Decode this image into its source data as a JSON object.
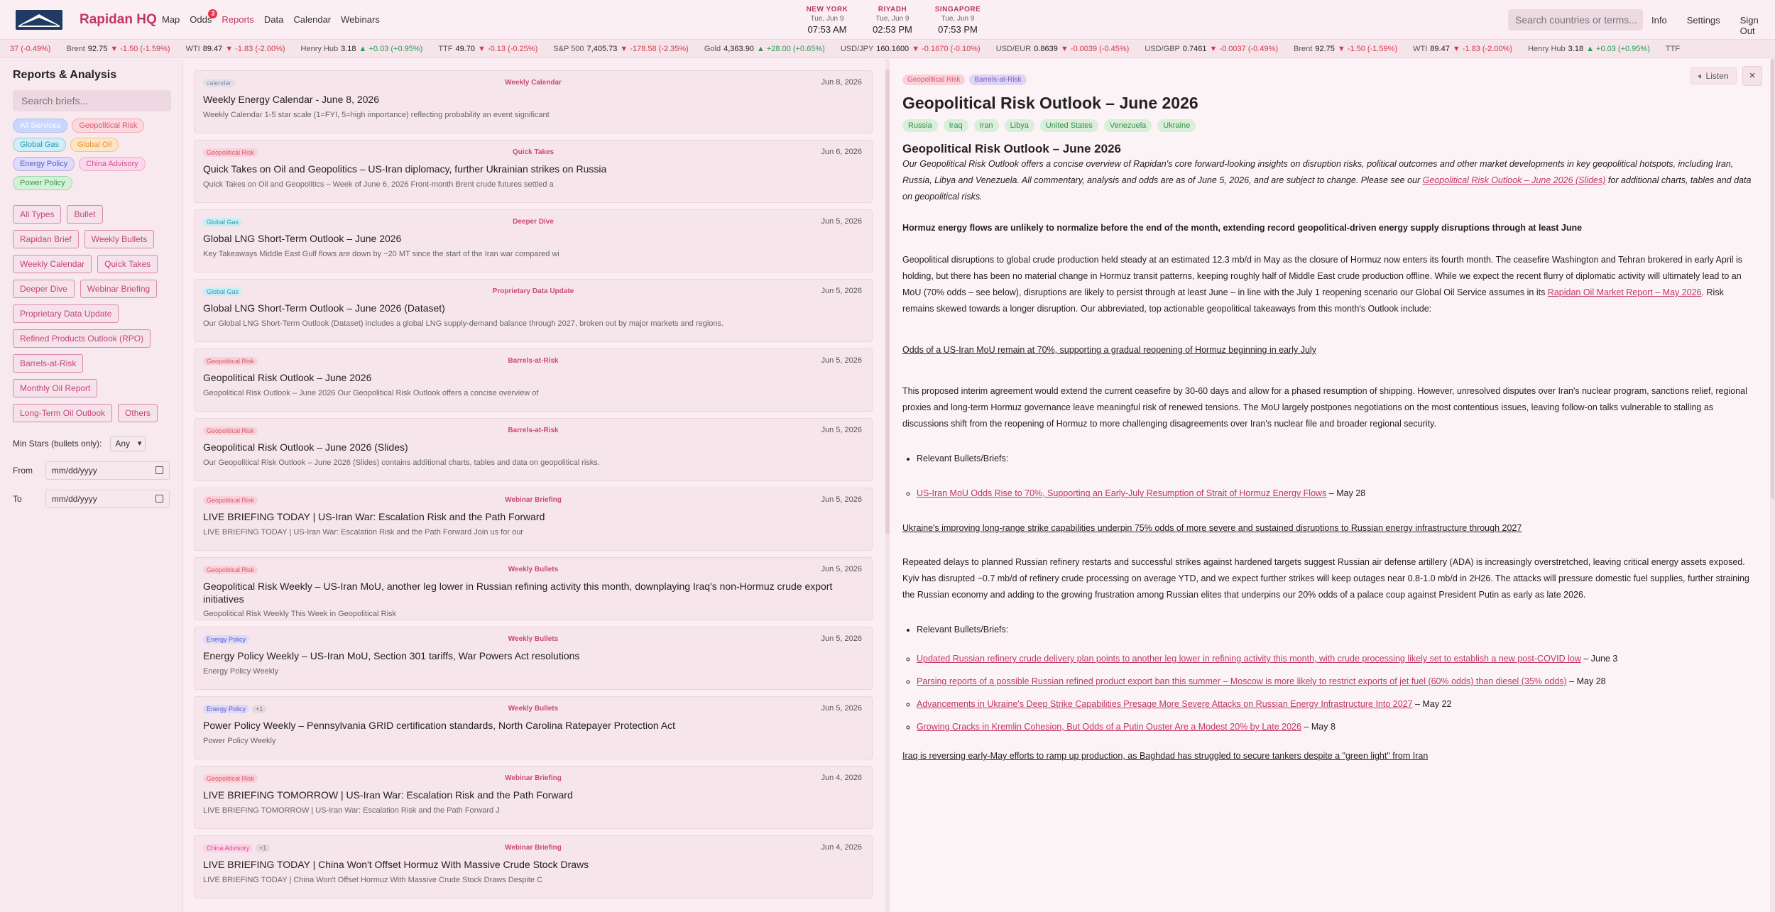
{
  "header": {
    "brand": "Rapidan HQ",
    "nav": [
      {
        "label": "Map",
        "active": false,
        "badge": ""
      },
      {
        "label": "Odds",
        "active": false,
        "badge": "3"
      },
      {
        "label": "Reports",
        "active": true,
        "badge": ""
      },
      {
        "label": "Data",
        "active": false,
        "badge": ""
      },
      {
        "label": "Calendar",
        "active": false,
        "badge": ""
      },
      {
        "label": "Webinars",
        "active": false,
        "badge": ""
      }
    ],
    "clocks": [
      {
        "city": "NEW YORK",
        "date": "Tue, Jun 9",
        "time": "07:53 AM"
      },
      {
        "city": "RIYADH",
        "date": "Tue, Jun 9",
        "time": "02:53 PM"
      },
      {
        "city": "SINGAPORE",
        "date": "Tue, Jun 9",
        "time": "07:53 PM"
      }
    ],
    "search_placeholder": "Search countries or terms...",
    "links": [
      "Info",
      "Settings",
      "Sign Out"
    ]
  },
  "ticker": [
    {
      "name": "",
      "value": "",
      "change": "37 (-0.49%)",
      "dir": "down"
    },
    {
      "name": "Brent",
      "value": "92.75",
      "change": "▼ -1.50 (-1.59%)",
      "dir": "down"
    },
    {
      "name": "WTI",
      "value": "89.47",
      "change": "▼ -1.83 (-2.00%)",
      "dir": "down"
    },
    {
      "name": "Henry Hub",
      "value": "3.18",
      "change": "▲ +0.03 (+0.95%)",
      "dir": "up"
    },
    {
      "name": "TTF",
      "value": "49.70",
      "change": "▼ -0.13 (-0.25%)",
      "dir": "down"
    },
    {
      "name": "S&P 500",
      "value": "7,405.73",
      "change": "▼ -178.58 (-2.35%)",
      "dir": "down"
    },
    {
      "name": "Gold",
      "value": "4,363.90",
      "change": "▲ +28.00 (+0.65%)",
      "dir": "up"
    },
    {
      "name": "USD/JPY",
      "value": "160.1600",
      "change": "▼ -0.1670 (-0.10%)",
      "dir": "down"
    },
    {
      "name": "USD/EUR",
      "value": "0.8639",
      "change": "▼ -0.0039 (-0.45%)",
      "dir": "down"
    },
    {
      "name": "USD/GBP",
      "value": "0.7461",
      "change": "▼ -0.0037 (-0.49%)",
      "dir": "down"
    },
    {
      "name": "Brent",
      "value": "92.75",
      "change": "▼ -1.50 (-1.59%)",
      "dir": "down"
    },
    {
      "name": "WTI",
      "value": "89.47",
      "change": "▼ -1.83 (-2.00%)",
      "dir": "down"
    },
    {
      "name": "Henry Hub",
      "value": "3.18",
      "change": "▲ +0.03 (+0.95%)",
      "dir": "up"
    },
    {
      "name": "TTF",
      "value": "",
      "change": "",
      "dir": "down"
    }
  ],
  "sidebar": {
    "title": "Reports & Analysis",
    "search_placeholder": "Search briefs...",
    "topic_chips": [
      {
        "label": "All Services",
        "cls": "all"
      },
      {
        "label": "Geopolitical Risk",
        "cls": "geo"
      },
      {
        "label": "Global Gas",
        "cls": "gas"
      },
      {
        "label": "Global Oil",
        "cls": "oil"
      },
      {
        "label": "Energy Policy",
        "cls": "energy"
      },
      {
        "label": "China Advisory",
        "cls": "china"
      },
      {
        "label": "Power Policy",
        "cls": "power"
      }
    ],
    "types": [
      "All Types",
      "Bullet",
      "Rapidan Brief",
      "Weekly Bullets",
      "Weekly Calendar",
      "Quick Takes",
      "Deeper Dive",
      "Webinar Briefing",
      "Proprietary Data Update",
      "Refined Products Outlook (RPO)",
      "Barrels-at-Risk",
      "Monthly Oil Report",
      "Long-Term Oil Outlook",
      "Others"
    ],
    "min_stars_label": "Min Stars (bullets only):",
    "min_stars_value": "Any",
    "from_label": "From",
    "to_label": "To",
    "date_placeholder": "mm/dd/yyyy"
  },
  "list": [
    {
      "tag": "calendar",
      "tag_cls": "calendar",
      "extra": "",
      "type": "Weekly Calendar",
      "date": "Jun 8, 2026",
      "title": "Weekly Energy Calendar - June 8, 2026",
      "excerpt": "Weekly Calendar 1-5 star scale (1=FYI, 5=high importance) reflecting probability an event significant"
    },
    {
      "tag": "Geopolitical Risk",
      "tag_cls": "geo",
      "extra": "",
      "type": "Quick Takes",
      "date": "Jun 6, 2026",
      "title": "Quick Takes on Oil and Geopolitics – US-Iran diplomacy, further Ukrainian strikes on Russia",
      "excerpt": "Quick Takes on Oil and Geopolitics – Week of June 6, 2026 Front-month Brent crude futures settled a"
    },
    {
      "tag": "Global Gas",
      "tag_cls": "gas",
      "extra": "",
      "type": "Deeper Dive",
      "date": "Jun 5, 2026",
      "title": "Global LNG Short-Term Outlook – June 2026",
      "excerpt": "Key Takeaways Middle East Gulf flows are down by ~20 MT since the start of the Iran war compared wi"
    },
    {
      "tag": "Global Gas",
      "tag_cls": "gas",
      "extra": "",
      "type": "Proprietary Data Update",
      "date": "Jun 5, 2026",
      "title": "Global LNG Short-Term Outlook – June 2026 (Dataset)",
      "excerpt": "Our Global LNG Short-Term Outlook (Dataset) includes a global LNG supply-demand balance through 2027, broken out by major markets and regions."
    },
    {
      "tag": "Geopolitical Risk",
      "tag_cls": "geo",
      "extra": "",
      "type": "Barrels-at-Risk",
      "date": "Jun 5, 2026",
      "title": "Geopolitical Risk Outlook – June 2026",
      "excerpt": "Geopolitical Risk Outlook – June 2026 Our Geopolitical Risk Outlook offers a concise overview of"
    },
    {
      "tag": "Geopolitical Risk",
      "tag_cls": "geo",
      "extra": "",
      "type": "Barrels-at-Risk",
      "date": "Jun 5, 2026",
      "title": "Geopolitical Risk Outlook – June 2026 (Slides)",
      "excerpt": "Our Geopolitical Risk Outlook – June 2026 (Slides) contains additional charts, tables and data on geopolitical risks."
    },
    {
      "tag": "Geopolitical Risk",
      "tag_cls": "geo",
      "extra": "",
      "type": "Webinar Briefing",
      "date": "Jun 5, 2026",
      "title": "LIVE BRIEFING TODAY | US-Iran War: Escalation Risk and the Path Forward",
      "excerpt": "LIVE BRIEFING TODAY | US-Iran War: Escalation Risk and the Path Forward   Join us for our"
    },
    {
      "tag": "Geopolitical Risk",
      "tag_cls": "geo",
      "extra": "",
      "type": "Weekly Bullets",
      "date": "Jun 5, 2026",
      "title": "Geopolitical Risk Weekly – US-Iran MoU, another leg lower in Russian refining activity this month, downplaying Iraq's non-Hormuz crude export initiatives",
      "excerpt": "Geopolitical Risk Weekly    This Week in Geopolitical Risk"
    },
    {
      "tag": "Energy Policy",
      "tag_cls": "energy",
      "extra": "",
      "type": "Weekly Bullets",
      "date": "Jun 5, 2026",
      "title": "Energy Policy Weekly – US-Iran MoU, Section 301 tariffs, War Powers Act resolutions",
      "excerpt": "Energy Policy Weekly"
    },
    {
      "tag": "Energy Policy",
      "tag_cls": "energy",
      "extra": "+1",
      "type": "Weekly Bullets",
      "date": "Jun 5, 2026",
      "title": "Power Policy Weekly – Pennsylvania GRID certification standards, North Carolina Ratepayer Protection Act",
      "excerpt": "Power Policy Weekly"
    },
    {
      "tag": "Geopolitical Risk",
      "tag_cls": "geo",
      "extra": "",
      "type": "Webinar Briefing",
      "date": "Jun 4, 2026",
      "title": "LIVE BRIEFING TOMORROW | US-Iran War: Escalation Risk and the Path Forward",
      "excerpt": "LIVE BRIEFING TOMORROW | US-Iran War: Escalation Risk and the Path Forward     J"
    },
    {
      "tag": "China Advisory",
      "tag_cls": "china",
      "extra": "+1",
      "type": "Webinar Briefing",
      "date": "Jun 4, 2026",
      "title": "LIVE BRIEFING TODAY | China Won't Offset Hormuz With Massive Crude Stock Draws",
      "excerpt": "LIVE BRIEFING TODAY | China Won't Offset Hormuz With Massive Crude Stock Draws    Despite C"
    }
  ],
  "reader": {
    "tags": [
      {
        "label": "Geopolitical Risk",
        "cls": "geo"
      },
      {
        "label": "Barrels-at-Risk",
        "cls": "bar"
      }
    ],
    "listen_label": "Listen",
    "close_label": "×",
    "title": "Geopolitical Risk Outlook – June 2026",
    "countries": [
      "Russia",
      "Iraq",
      "Iran",
      "Libya",
      "United States",
      "Venezuela",
      "Ukraine"
    ],
    "subtitle": "Geopolitical Risk Outlook – June 2026",
    "intro_a": "Our Geopolitical Risk Outlook offers a concise overview of Rapidan's core forward-looking insights on disruption risks, political outcomes and other market developments in key geopolitical hotspots, including Iran, Russia, Libya and Venezuela. All commentary, analysis and odds are as of June 5,  2026, and are subject to change. Please see our ",
    "intro_link": "Geopolitical Risk Outlook – June 2026 (Slides)",
    "intro_b": " for additional charts, tables and data on geopolitical risks.",
    "hormuz_heading": "Hormuz energy flows are unlikely to normalize before the end of the month, extending record geopolitical-driven energy supply disruptions through at least June",
    "p1_a": "Geopolitical disruptions to global crude production held steady at an estimated 12.3 mb/d in May as the closure of Hormuz now enters its fourth month. The ceasefire Washington and Tehran brokered in early April is holding, but there has been no material change in Hormuz transit patterns, keeping roughly half of Middle East crude production offline. While we expect the recent flurry of diplomatic activity will ultimately lead to an MoU (70% odds – see below), disruptions are likely to persist through at least June – in line with the July 1 reopening scenario our Global Oil Service assumes in its ",
    "p1_link": "Rapidan Oil Market Report – May 2026",
    "p1_b": ". Risk remains skewed towards a longer disruption. Our abbreviated, top actionable geopolitical takeaways from this month's Outlook include:",
    "h_mou": "Odds of a US-Iran MoU remain at 70%, supporting a gradual reopening of Hormuz beginning in early July",
    "p2": "This proposed interim agreement would extend the current ceasefire by 30-60 days and allow for a phased resumption of shipping. However, unresolved disputes over Iran's nuclear program, sanctions relief, regional proxies and long-term Hormuz governance leave meaningful risk of renewed tensions. The MoU largely postpones negotiations on the most contentious issues, leaving follow-on talks vulnerable to stalling as discussions shift from the reopening of Hormuz to more challenging disagreements over Iran's nuclear file and broader regional security.",
    "relevant_label": "Relevant Bullets/Briefs:",
    "mou_links": [
      {
        "text": "US-Iran MoU Odds Rise to 70%, Supporting an Early-July Resumption of Strait of Hormuz Energy Flows",
        "date": " – May 28"
      }
    ],
    "h_ukraine": "Ukraine's improving long-range strike capabilities underpin 75% odds of more severe and sustained disruptions to Russian energy infrastructure through 2027",
    "p3": "Repeated delays to planned Russian refinery restarts and successful strikes against hardened targets suggest Russian air defense artillery (ADA) is increasingly overstretched, leaving critical energy assets exposed. Kyiv has disrupted ~0.7 mb/d of refinery crude processing on average YTD, and we expect further strikes will keep outages near 0.8-1.0 mb/d in 2H26. The attacks will pressure domestic fuel supplies, further straining the Russian economy and adding to the growing frustration among Russian elites that underpins our 20% odds of a palace coup against President Putin as early as late 2026.",
    "ukraine_links": [
      {
        "text": "Updated Russian refinery crude delivery plan points to another leg lower in refining activity this month, with crude processing likely set to establish a new post-COVID low",
        "date": " – June 3"
      },
      {
        "text": "Parsing reports of a possible Russian refined product export ban this summer – Moscow is more likely to restrict exports of jet fuel (60% odds) than diesel (35% odds)",
        "date": " – May 28"
      },
      {
        "text": "Advancements in Ukraine's Deep Strike Capabilities Presage More Severe Attacks on Russian Energy Infrastructure Into 2027",
        "date": " – May 22"
      },
      {
        "text": "Growing Cracks in Kremlin Cohesion, But Odds of a Putin Ouster Are a Modest 20% by Late 2026",
        "date": " – May 8"
      }
    ],
    "h_iraq": "Iraq is reversing early-May efforts to ramp up production, as Baghdad has struggled to secure tankers despite a \"green light\" from Iran"
  }
}
